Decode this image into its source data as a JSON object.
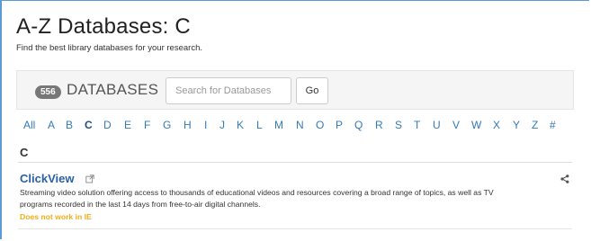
{
  "page": {
    "title": "A-Z Databases: C",
    "description": "Find the best library databases for your research."
  },
  "search": {
    "count": "556",
    "label": "DATABASES",
    "placeholder": "Search for Databases",
    "go_label": "Go"
  },
  "az_nav": {
    "items": [
      "All",
      "A",
      "B",
      "C",
      "D",
      "E",
      "F",
      "G",
      "H",
      "I",
      "J",
      "K",
      "L",
      "M",
      "N",
      "O",
      "P",
      "Q",
      "R",
      "S",
      "T",
      "U",
      "V",
      "W",
      "X",
      "Y",
      "Z",
      "#"
    ],
    "active": "C"
  },
  "section": {
    "letter": "C"
  },
  "entry": {
    "title": "ClickView",
    "description_line1": "Streaming video solution offering access to thousands of educational videos and resources covering a broad range of topics, as well as TV",
    "description_line2": "programs recorded in the last 14 days from free-to-air digital channels.",
    "warning": "Does not work in IE"
  },
  "icons": {
    "external_link": "external-link-icon",
    "share": "share-icon"
  },
  "colors": {
    "link": "#337ab7",
    "active_letter": "#1f4f82",
    "title": "#2a5fa5",
    "warning": "#f0ad1a",
    "badge": "#777777",
    "frame": "#5b9bd5"
  }
}
